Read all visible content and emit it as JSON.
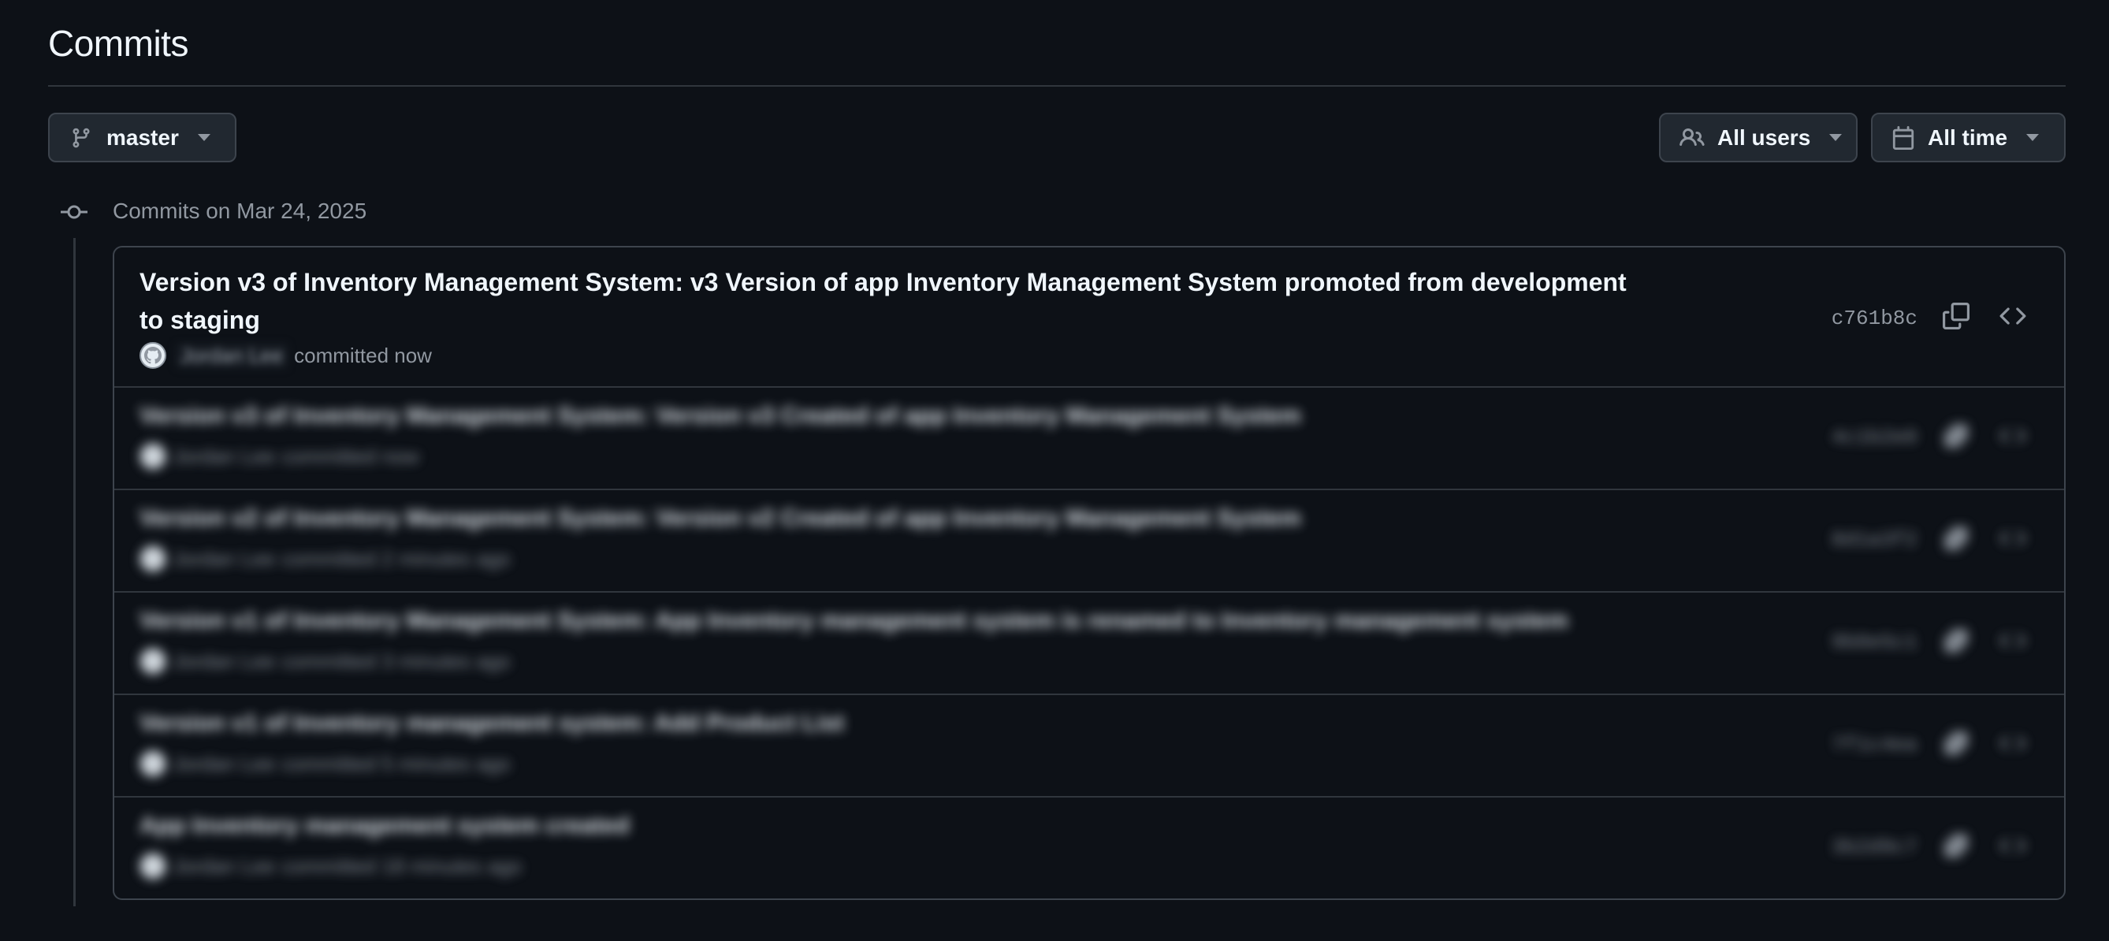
{
  "page": {
    "title": "Commits"
  },
  "toolbar": {
    "branch_label": "master",
    "users_label": "All users",
    "time_label": "All time"
  },
  "timeline": {
    "date_heading": "Commits on Mar 24, 2025"
  },
  "commits": [
    {
      "title": "Version v3 of Inventory Management System: v3 Version of app Inventory Management System promoted from development to staging",
      "author": "Jordan Lee",
      "time": "committed now",
      "sha": "c761b8c"
    },
    {
      "title": "Version v3 of Inventory Management System: Version v3 Created of app Inventory Management System",
      "author": "Jordan Lee",
      "time": "committed now",
      "sha": "4c1b2e0"
    },
    {
      "title": "Version v2 of Inventory Management System: Version v2 Created of app Inventory Management System",
      "author": "Jordan Lee",
      "time": "committed 2 minutes ago",
      "sha": "8d1a3f2"
    },
    {
      "title": "Version v1 of Inventory Management System: App Inventory management system is renamed to Inventory management system",
      "author": "Jordan Lee",
      "time": "committed 3 minutes ago",
      "sha": "9b0e5c1"
    },
    {
      "title": "Version v1 of Inventory management system: Add Product List",
      "author": "Jordan Lee",
      "time": "committed 5 minutes ago",
      "sha": "7f1c4ea"
    },
    {
      "title": "App Inventory management system created",
      "author": "Jordan Lee",
      "time": "committed 18 minutes ago",
      "sha": "3b2d9c7"
    }
  ],
  "colors": {
    "background": "#0d1117",
    "border": "#3d444d",
    "text": "#f0f6fc",
    "muted": "#9198a1"
  }
}
